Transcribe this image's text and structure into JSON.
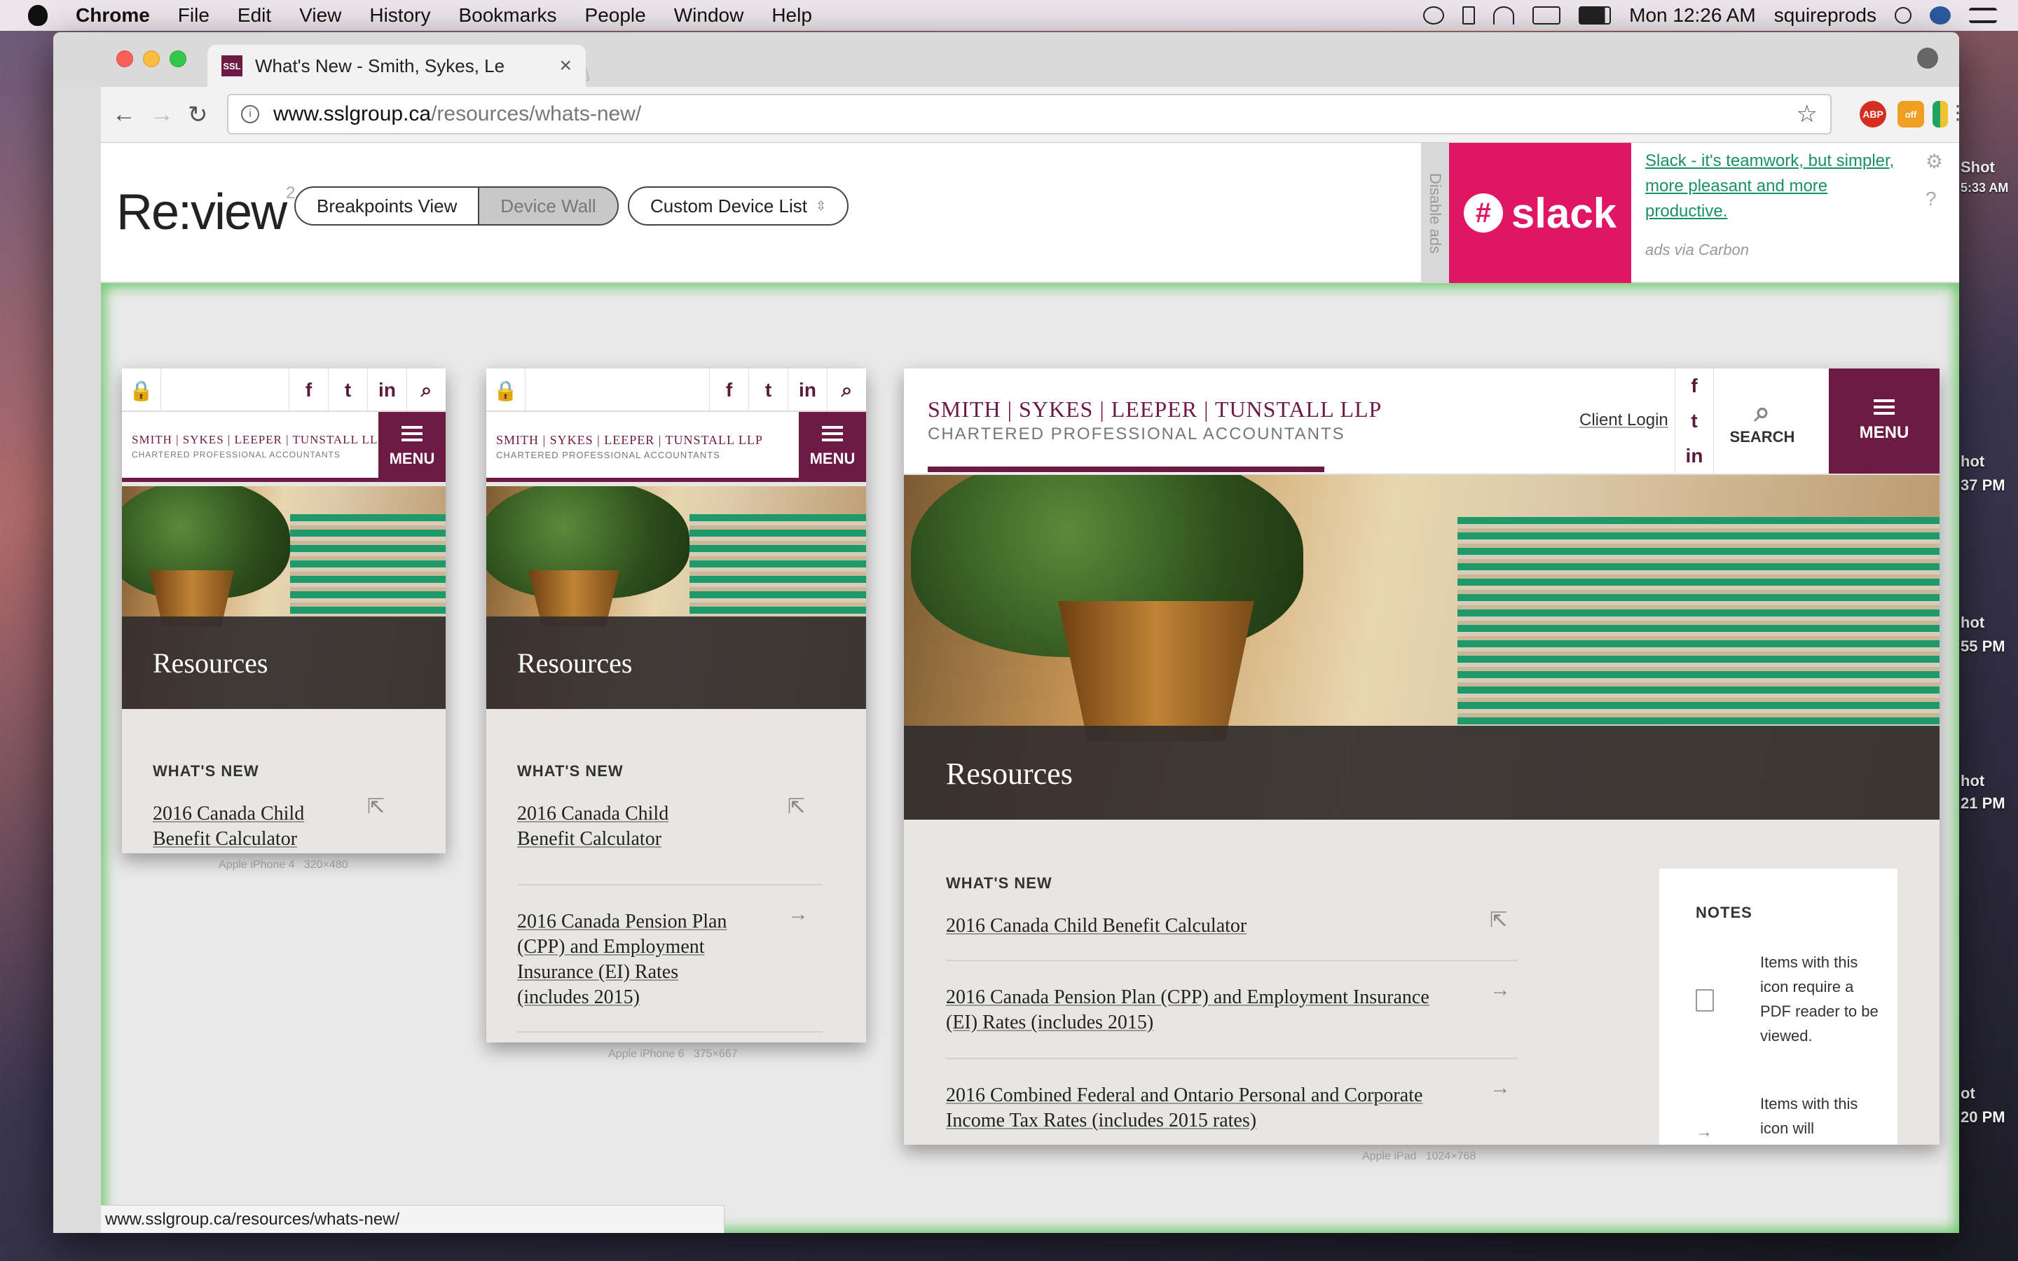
{
  "menubar": {
    "app": "Chrome",
    "items": [
      "File",
      "Edit",
      "View",
      "History",
      "Bookmarks",
      "People",
      "Window",
      "Help"
    ],
    "clock": "Mon 12:26 AM",
    "user": "squireprods"
  },
  "side_labels": [
    "Shot",
    "5:33 AM",
    "hot",
    "37 PM",
    "hot",
    "55 PM",
    "hot",
    "21 PM",
    "ot",
    "20 PM"
  ],
  "browser": {
    "tab_title": "What's New - Smith, Sykes, Le",
    "tab_favicon": "SSL",
    "url_host": "www.sslgroup.ca",
    "url_path": "/resources/whats-new/",
    "status_url": "www.sslgroup.ca/resources/whats-new/",
    "ext_abp": "ABP",
    "ext_off": "off"
  },
  "review": {
    "logo": "Re:view",
    "logo_sup": "2",
    "seg_breakpoints": "Breakpoints View",
    "seg_devicewall": "Device Wall",
    "custom_list": "Custom Device List",
    "disable_ads": "Disable ads",
    "ad_brand": "slack",
    "ad_text": "Slack - it's teamwork, but simpler, more pleasant and more productive.",
    "ad_via": "ads via Carbon"
  },
  "site": {
    "brand_line1": "SMITH | SYKES | LEEPER | TUNSTALL LLP",
    "brand_line2": "CHARTERED PROFESSIONAL ACCOUNTANTS",
    "menu": "MENU",
    "search": "SEARCH",
    "client_login": "Client Login",
    "hero_title": "Resources",
    "section": "WHAT'S NEW",
    "notes_title": "NOTES",
    "notes_1": "Items with this icon require a PDF reader to be viewed.",
    "notes_2": "Items with this icon will",
    "links": [
      "2016 Canada Child Benefit Calculator",
      "2016 Canada Pension Plan (CPP) and Employment Insurance (EI) Rates (includes 2015)",
      "2016 Combined Federal and Ontario Personal and Corporate Income Tax Rates (includes 2015 rates)"
    ]
  },
  "devices": [
    {
      "name": "Apple iPhone 4",
      "size": "320×480"
    },
    {
      "name": "Apple iPhone 6",
      "size": "375×667"
    },
    {
      "name": "Apple iPad",
      "size": "1024×768"
    }
  ],
  "colors": {
    "brand": "#6d1a45",
    "slack": "#e01563",
    "glow": "#6fc96f"
  }
}
